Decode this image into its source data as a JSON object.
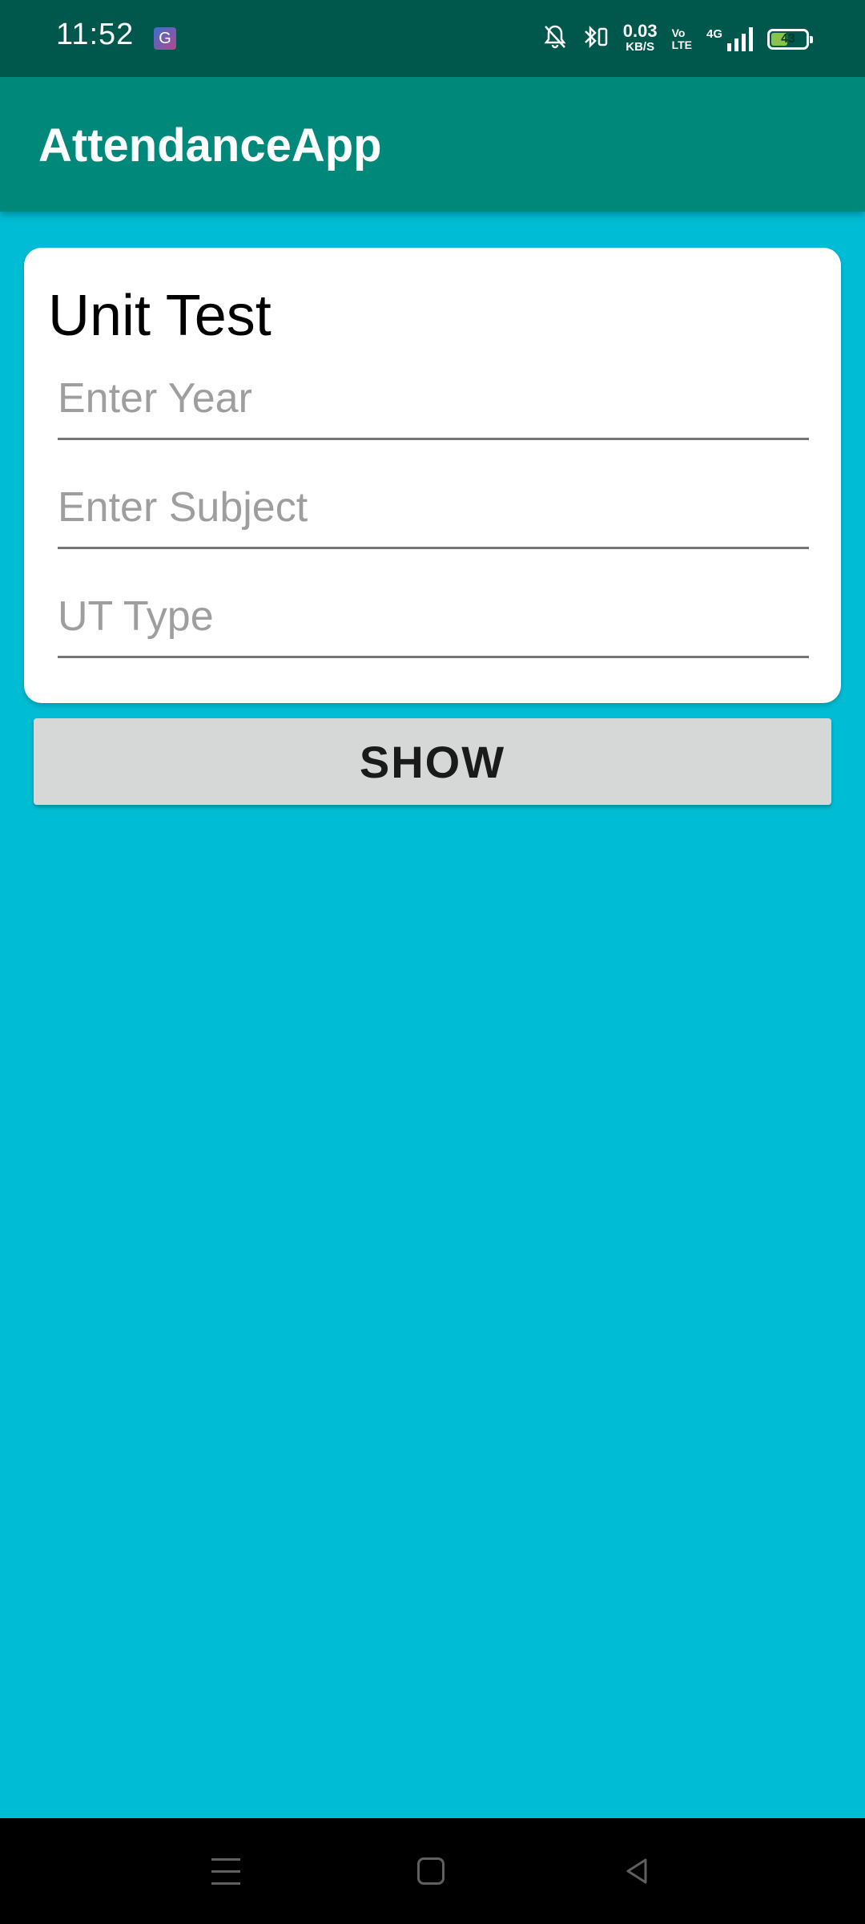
{
  "status_bar": {
    "time": "11:52",
    "app_icon_letter": "G",
    "net_speed": "0.03",
    "net_speed_unit": "KB/S",
    "volte_top": "Vo",
    "volte_bottom": "LTE",
    "network": "4G",
    "battery_level": "43",
    "icons": [
      "notifications-off-icon",
      "bluetooth-icon",
      "signal-icon",
      "battery-icon"
    ]
  },
  "app_bar": {
    "title": "AttendanceApp"
  },
  "form": {
    "title": "Unit Test",
    "year_placeholder": "Enter Year",
    "year_value": "",
    "subject_placeholder": "Enter Subject",
    "subject_value": "",
    "ut_type_placeholder": "UT Type",
    "ut_type_value": ""
  },
  "actions": {
    "show_label": "SHOW"
  },
  "nav_bar": {
    "icons": [
      "menu-icon",
      "home-icon",
      "back-icon"
    ]
  },
  "colors": {
    "status_bar": "#00574B",
    "app_bar": "#00897B",
    "background": "#00BCD4",
    "card": "#FFFFFF",
    "button": "#D6D7D7"
  }
}
